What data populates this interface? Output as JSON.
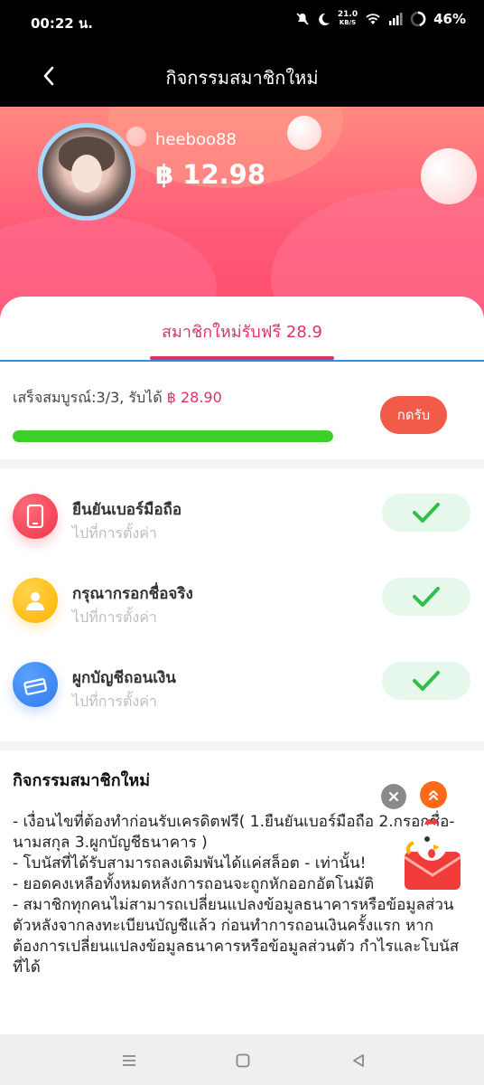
{
  "status_bar": {
    "time": "00:22 น.",
    "net_speed_value": "21.0",
    "net_speed_unit": "KB/S",
    "battery": "46%"
  },
  "header": {
    "title": "กิจกรรมสมาชิกใหม่"
  },
  "profile": {
    "username": "heeboo88",
    "balance": "฿ 12.98"
  },
  "tab": {
    "label": "สมาชิกใหม่รับฟรี 28.9"
  },
  "progress": {
    "status_prefix": "เสร็จสมบูรณ์:3/3, รับได้",
    "reward": "฿ 28.90",
    "fraction": 1.0,
    "claim_label": "กดรับ",
    "fill_color": "#3fcf2a"
  },
  "tasks": [
    {
      "title": "ยืนยันเบอร์มือถือ",
      "subtitle": "ไปที่การตั้งค่า",
      "icon": "phone-icon",
      "color": "#f0344a",
      "done": true
    },
    {
      "title": "กรุณากรอกชื่อจริง",
      "subtitle": "ไปที่การตั้งค่า",
      "icon": "user-icon",
      "color": "#ffb300",
      "done": true
    },
    {
      "title": "ผูกบัญชีถอนเงิน",
      "subtitle": "ไปที่การตั้งค่า",
      "icon": "card-icon",
      "color": "#2f7bea",
      "done": true
    }
  ],
  "rules": {
    "title": "กิจกรรมสมาชิกใหม่",
    "body": "- เงื่อนไขที่ต้องทำก่อนรับเครดิตฟรี( 1.ยืนยันเบอร์มือถือ  2.กรอกชื่อ-นามสกุล  3.ผูกบัญชีธนาคาร )\n- โบนัสที่ได้รับสามารถลงเดิมพันได้แค่สล็อต - เท่านั้น!\n- ยอดคงเหลือทั้งหมดหลังการถอนจะถูกหักออกอัตโนมัติ\n- สมาชิกทุกคนไม่สามารถเปลี่ยนแปลงข้อมูลธนาคารหรือข้อมูลส่วนตัวหลังจากลงทะเบียนบัญชีแล้ว ก่อนทำการถอนเงินครั้งแรก หากต้องการเปลี่ยนแปลงข้อมูลธนาคารหรือข้อมูลส่วนตัว กำไรและโบนัสที่ได้"
  },
  "colors": {
    "accent": "#e0306a",
    "tab_divider": "#2f8de4",
    "claim_button": "#f25a4a",
    "check": "#2fbf4a"
  }
}
